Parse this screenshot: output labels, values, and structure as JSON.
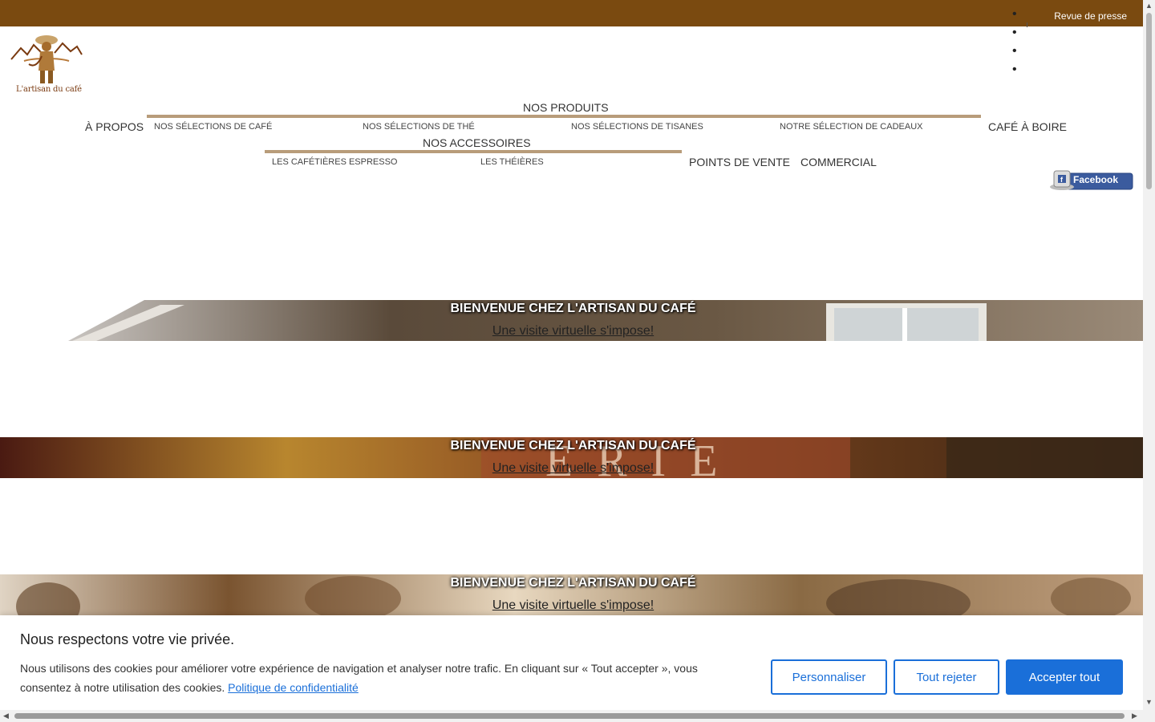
{
  "topbar": {
    "link_label": "Revue de presse",
    "color": "#7a4a10"
  },
  "logo": {
    "text": "L'artisan du café",
    "icon": "coffee-farmer-logo"
  },
  "nav": {
    "produits": "NOS PRODUITS",
    "apropos": "À PROPOS",
    "produits_sub": [
      "NOS SÉLECTIONS DE CAFÉ",
      "NOS SÉLECTIONS DE THÉ",
      "NOS SÉLECTIONS DE TISANES",
      "NOTRE SÉLECTION DE CADEAUX"
    ],
    "cafe_a_boire": "CAFÉ À BOIRE",
    "accessoires": "NOS ACCESSOIRES",
    "accessoires_sub": [
      "LES CAFÉTIÈRES ESPRESSO",
      "LES THÉIÈRES"
    ],
    "points_de_vente": "POINTS DE VENTE",
    "commercial": "COMMERCIAL",
    "accent_color": "#b89c7a"
  },
  "facebook": {
    "label": "Facebook",
    "icon": "facebook-icon"
  },
  "banners": [
    {
      "title": "BIENVENUE CHEZ L'ARTISAN DU CAFÉ",
      "link": "Une visite virtuelle s'impose!"
    },
    {
      "title": "BIENVENUE CHEZ L'ARTISAN DU CAFÉ",
      "link": "Une visite virtuelle s'impose!"
    },
    {
      "title": "BIENVENUE CHEZ L'ARTISAN DU CAFÉ",
      "link": "Une visite virtuelle s'impose!"
    }
  ],
  "cookie": {
    "title": "Nous respectons votre vie privée.",
    "text": "Nous utilisons des cookies pour améliorer votre expérience de navigation et analyser notre trafic. En cliquant sur « Tout accepter », vous consentez à notre utilisation des cookies.",
    "policy_link": "Politique de confidentialité",
    "customize": "Personnaliser",
    "reject": "Tout rejeter",
    "accept": "Accepter tout",
    "button_color": "#1a6fd9"
  }
}
